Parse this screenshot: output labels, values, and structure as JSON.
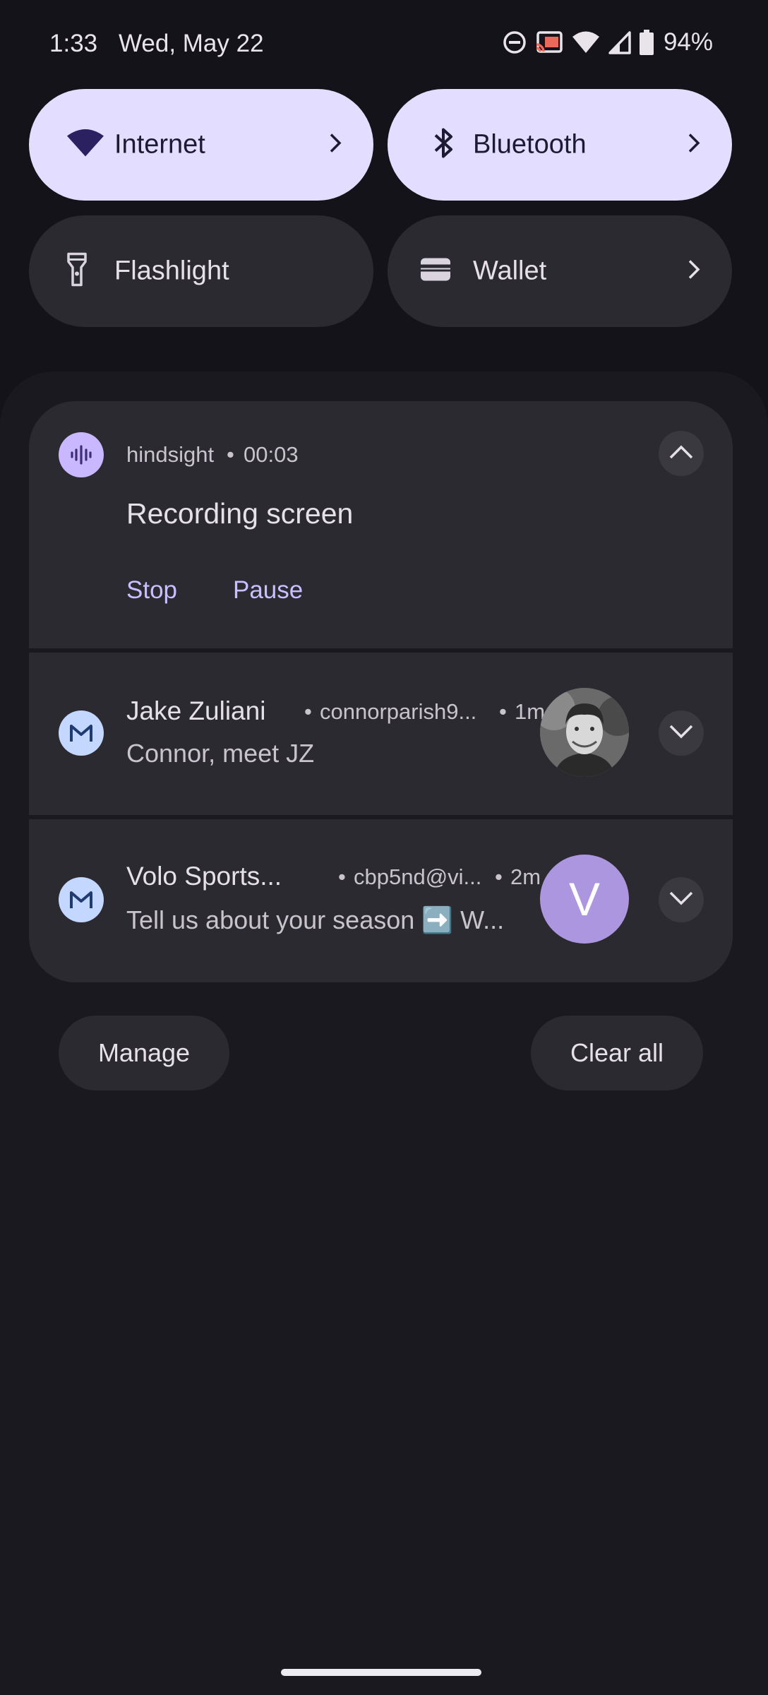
{
  "status_bar": {
    "time": "1:33",
    "date": "Wed, May 22",
    "battery_percent": "94%",
    "icons": [
      "do-not-disturb-icon",
      "cast-icon",
      "wifi-icon",
      "cell-signal-icon",
      "battery-icon"
    ]
  },
  "quick_settings": {
    "tiles": [
      {
        "label": "Internet",
        "icon": "wifi-icon",
        "active": true,
        "has_chevron": true
      },
      {
        "label": "Bluetooth",
        "icon": "bluetooth-icon",
        "active": true,
        "has_chevron": true
      },
      {
        "label": "Flashlight",
        "icon": "flashlight-icon",
        "active": false,
        "has_chevron": false
      },
      {
        "label": "Wallet",
        "icon": "wallet-icon",
        "active": false,
        "has_chevron": true
      }
    ]
  },
  "notifications": [
    {
      "app": "hindsight",
      "elapsed": "00:03",
      "title": "Recording screen",
      "actions": [
        "Stop",
        "Pause"
      ],
      "app_icon": "audio-wave-icon",
      "expanded": true
    },
    {
      "sender": "Jake Zuliani",
      "account": "connorparish9...",
      "time": "1m",
      "body": "Connor, meet JZ",
      "app_icon": "gmail-icon",
      "avatar": "photo"
    },
    {
      "sender": "Volo Sports...",
      "account": "cbp5nd@vi...",
      "time": "2m",
      "body": "Tell us about your season ➡️ W...",
      "app_icon": "gmail-icon",
      "avatar_letter": "V"
    }
  ],
  "footer": {
    "manage_label": "Manage",
    "clear_all_label": "Clear all"
  },
  "colors": {
    "background": "#141319",
    "active_tile": "#e3deff",
    "inactive_tile": "#2b2a31",
    "accent": "#c7bfff",
    "avatar_v": "#ad96e0"
  }
}
